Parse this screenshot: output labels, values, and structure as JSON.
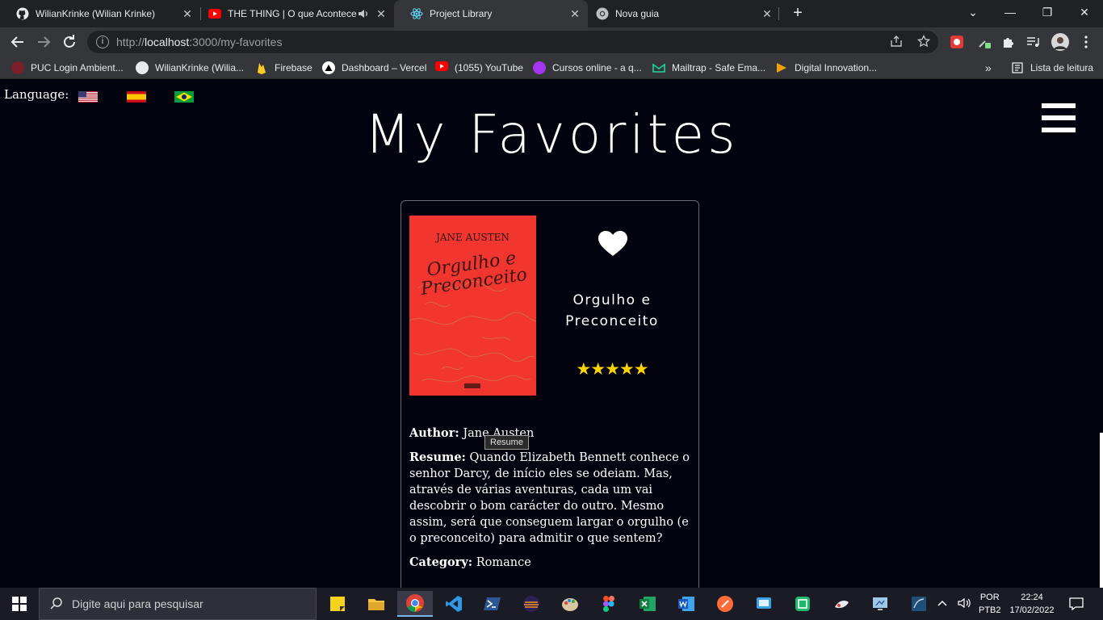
{
  "browser": {
    "tabs": [
      {
        "title": "WilianKrinke (Wilian Krinke)",
        "icon": "github-icon"
      },
      {
        "title": "THE THING | O que Acontece",
        "icon": "youtube-icon",
        "audio": true
      },
      {
        "title": "Project Library",
        "icon": "react-icon",
        "active": true
      },
      {
        "title": "Nova guia",
        "icon": "chrome-icon"
      }
    ],
    "close_glyph": "✕",
    "new_tab_glyph": "+",
    "window_controls": {
      "minimize": "⌄",
      "restore": "—",
      "maximize": "❐",
      "close": "✕"
    },
    "url_prefix": "http://",
    "url_host": "localhost",
    "url_path": ":3000/my-favorites",
    "bookmarks": [
      {
        "label": "PUC Login Ambient...",
        "icon": "puc-icon"
      },
      {
        "label": "WilianKrinke (Wilia...",
        "icon": "github-icon"
      },
      {
        "label": "Firebase",
        "icon": "firebase-icon"
      },
      {
        "label": "Dashboard – Vercel",
        "icon": "vercel-icon"
      },
      {
        "label": "(1055) YouTube",
        "icon": "youtube-icon"
      },
      {
        "label": "Cursos online - a q...",
        "icon": "udemy-icon"
      },
      {
        "label": "Mailtrap - Safe Ema...",
        "icon": "mailtrap-icon"
      },
      {
        "label": "Digital Innovation...",
        "icon": "dio-icon"
      }
    ],
    "overflow_glyph": "»",
    "reading_list": "Lista de leitura"
  },
  "page": {
    "language_label": "Language:",
    "flags": [
      "us-flag",
      "spain-flag",
      "brazil-flag"
    ],
    "title": "My Favorites",
    "book": {
      "cover_author": "JANE AUSTEN",
      "cover_title": "Orgulho e Preconceito",
      "title": "Orgulho e Preconceito",
      "rating": 5,
      "stars": "★★★★★",
      "author_label": "Author:",
      "author": "Jane Austen",
      "resume_label": "Resume:",
      "resume": "Quando Elizabeth Bennett conhece o senhor Darcy, de início eles se odeiam. Mas, através de várias aventuras, cada um vai descobrir o bom carácter do outro. Mesmo assim, será que conseguem largar o orgulho (e o preconceito) para admitir o que sentem?",
      "category_label": "Category:",
      "category": "Romance"
    },
    "tooltip": "Resume"
  },
  "taskbar": {
    "search_placeholder": "Digite aqui para pesquisar",
    "lang_top": "POR",
    "lang_bottom": "PTB2",
    "time": "22:24",
    "date": "17/02/2022"
  }
}
